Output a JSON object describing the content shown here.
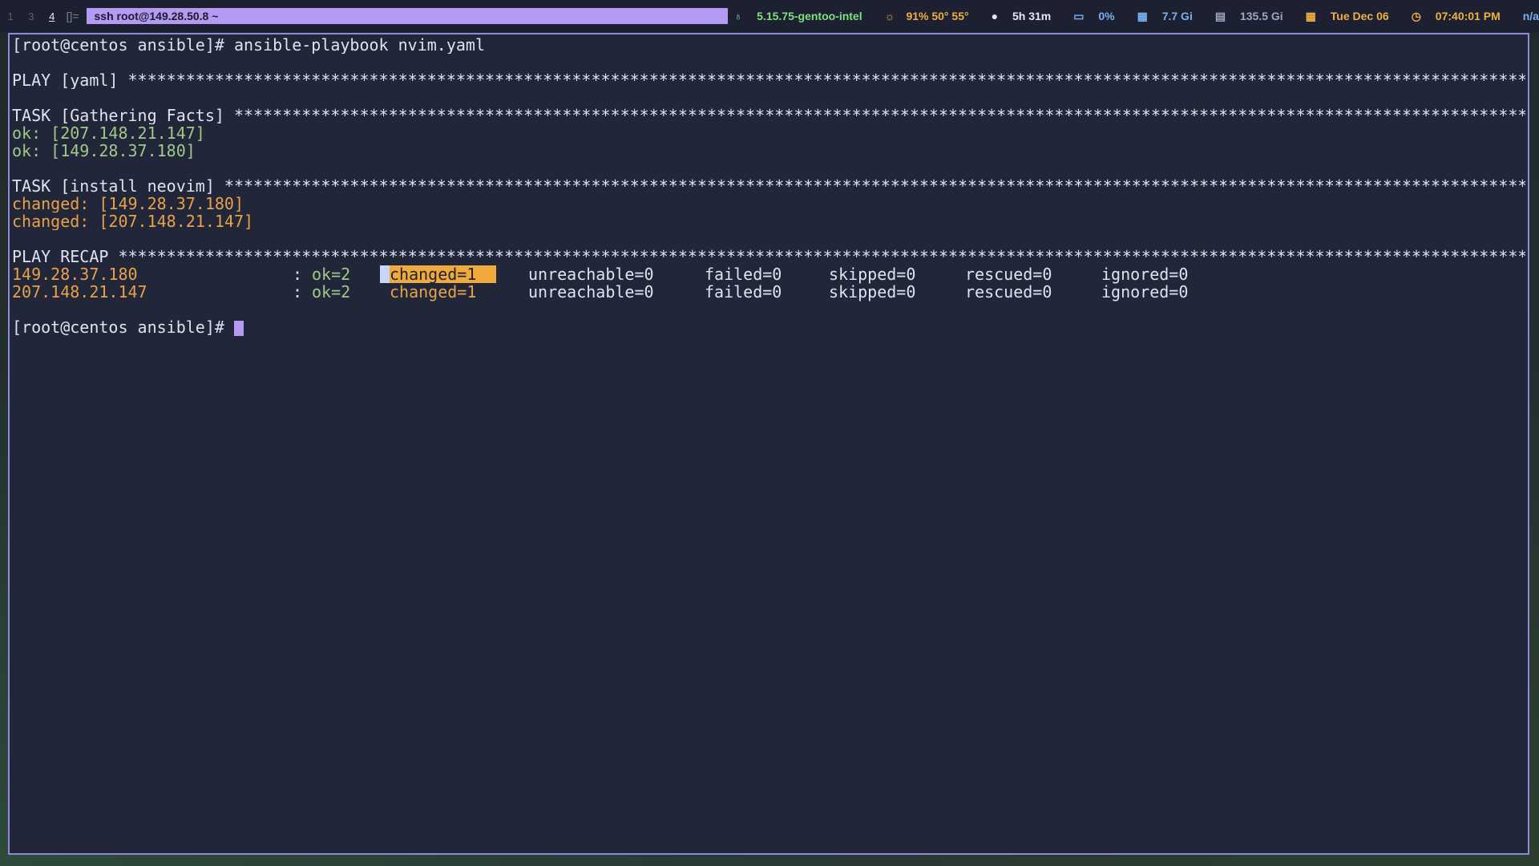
{
  "topbar": {
    "workspaces": [
      "1",
      "3",
      "4"
    ],
    "active_workspace": "4",
    "layout_icon": "[]=",
    "window_title": "ssh root@149.28.50.8 ~",
    "status": {
      "kernel": "5.15.75-gentoo-intel",
      "temps": "91% 50° 55°",
      "uptime": "5h 31m",
      "cpu": "0%",
      "mem": "7.7 Gi",
      "disk": "135.5 Gi",
      "date": "Tue Dec 06",
      "time": "07:40:01 PM",
      "extra": "n/a"
    }
  },
  "terminal": {
    "command_line": "[root@centos ansible]# ansible-playbook nvim.yaml",
    "play_header": "PLAY [yaml] *************************************************************************************************************************************************",
    "task1_header": "TASK [Gathering Facts] **************************************************************************************************************************************",
    "task1_results": [
      "ok: [207.148.21.147]",
      "ok: [149.28.37.180]"
    ],
    "task2_header": "TASK [install neovim] ***************************************************************************************************************************************",
    "task2_results": [
      "changed: [149.28.37.180]",
      "changed: [207.148.21.147]"
    ],
    "recap_header": "PLAY RECAP **************************************************************************************************************************************************",
    "recap_rows": [
      {
        "host": "149.28.37.180",
        "sep": ":",
        "ok": "ok=2",
        "changed": "changed=1",
        "unreachable": "unreachable=0",
        "failed": "failed=0",
        "skipped": "skipped=0",
        "rescued": "rescued=0",
        "ignored": "ignored=0"
      },
      {
        "host": "207.148.21.147",
        "sep": ":",
        "ok": "ok=2",
        "changed": "changed=1",
        "unreachable": "unreachable=0",
        "failed": "failed=0",
        "skipped": "skipped=0",
        "rescued": "rescued=0",
        "ignored": "ignored=0"
      }
    ],
    "prompt": "[root@centos ansible]# "
  },
  "colors": {
    "terminal_bg": "#212638",
    "accent": "#b49af0",
    "ok": "#9ec98a",
    "changed": "#e7a24a"
  }
}
